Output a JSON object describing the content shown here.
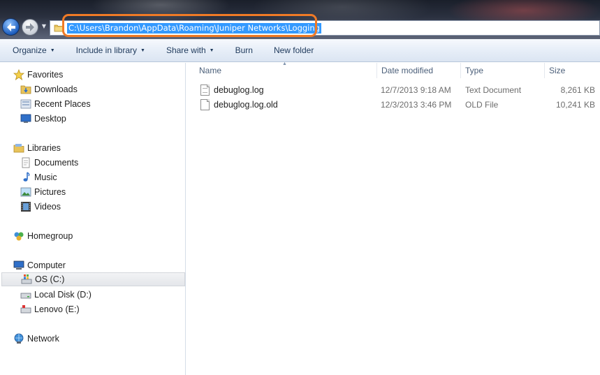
{
  "address": {
    "path": "C:\\Users\\Brandon\\AppData\\Roaming\\Juniper Networks\\Logging"
  },
  "icons": {
    "back": "back-arrow-icon",
    "forward": "forward-arrow-icon",
    "history": "chevron-down-icon",
    "address_folder": "folder-icon"
  },
  "toolbar": {
    "organize": "Organize",
    "include_library": "Include in library",
    "share_with": "Share with",
    "burn": "Burn",
    "new_folder": "New folder"
  },
  "nav": {
    "favorites": "Favorites",
    "downloads": "Downloads",
    "recent_places": "Recent Places",
    "desktop": "Desktop",
    "libraries": "Libraries",
    "documents": "Documents",
    "music": "Music",
    "pictures": "Pictures",
    "videos": "Videos",
    "homegroup": "Homegroup",
    "computer": "Computer",
    "os_c": "OS (C:)",
    "local_disk_d": "Local Disk (D:)",
    "lenovo_e": "Lenovo (E:)",
    "network": "Network"
  },
  "columns": {
    "name": "Name",
    "date_modified": "Date modified",
    "type": "Type",
    "size": "Size"
  },
  "files": [
    {
      "name": "debuglog.log",
      "date": "12/7/2013 9:18 AM",
      "type": "Text Document",
      "size": "8,261 KB"
    },
    {
      "name": "debuglog.log.old",
      "date": "12/3/2013 3:46 PM",
      "type": "OLD File",
      "size": "10,241 KB"
    }
  ],
  "colors": {
    "highlight_ring": "#f07a26",
    "selection": "#3399ff"
  }
}
